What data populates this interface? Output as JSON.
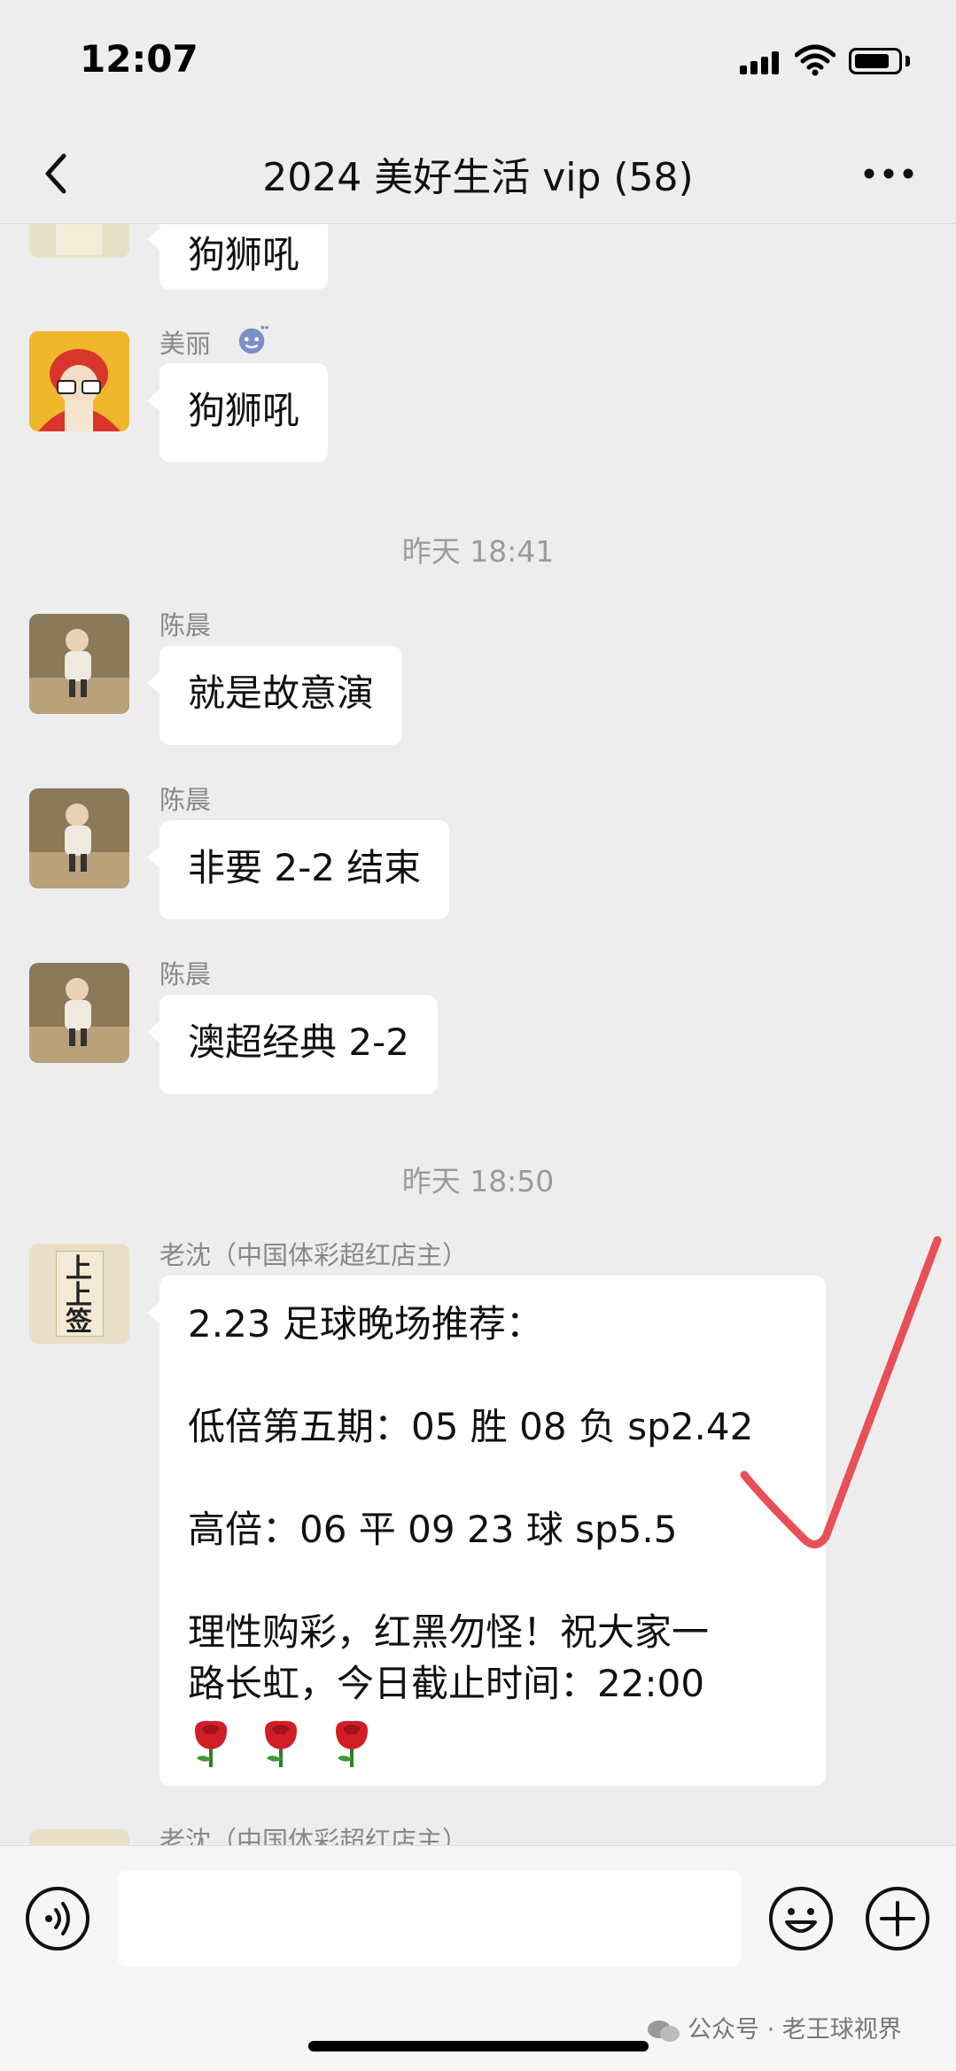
{
  "status_bar": {
    "time": "12:07"
  },
  "nav": {
    "title": "2024 美好生活 vip (58)"
  },
  "messages": [
    {
      "text": "狗狮吼"
    },
    {
      "sender": "美丽",
      "text": "狗狮吼"
    },
    {
      "sender": "陈晨",
      "text": "就是故意演"
    },
    {
      "sender": "陈晨",
      "text": "非要 2-2 结束"
    },
    {
      "sender": "陈晨",
      "text": "澳超经典 2-2"
    },
    {
      "sender": "老沈（中国体彩超红店主）",
      "lines": [
        "2.23 足球晚场推荐：",
        "低倍第五期：05 胜  08 负 sp2.42",
        "高倍：06 平 09 23 球 sp5.5",
        "理性购彩，红黑勿怪！祝大家一",
        "路长虹，今日截止时间：22:00"
      ]
    },
    {
      "sender": "老沈（中国体彩超红店主）"
    }
  ],
  "timestamps": [
    "昨天 18:41",
    "昨天 18:50"
  ],
  "avatar_sign_text": "上上签",
  "watermark": {
    "text": "公众号 · 老王球视界"
  },
  "colors": {
    "background": "#ededed",
    "bubble": "#ffffff",
    "check_mark": "#e84f57"
  },
  "icons": [
    "back-icon",
    "more-icon",
    "voice-icon",
    "emoji-icon",
    "plus-icon",
    "rose-icon"
  ]
}
